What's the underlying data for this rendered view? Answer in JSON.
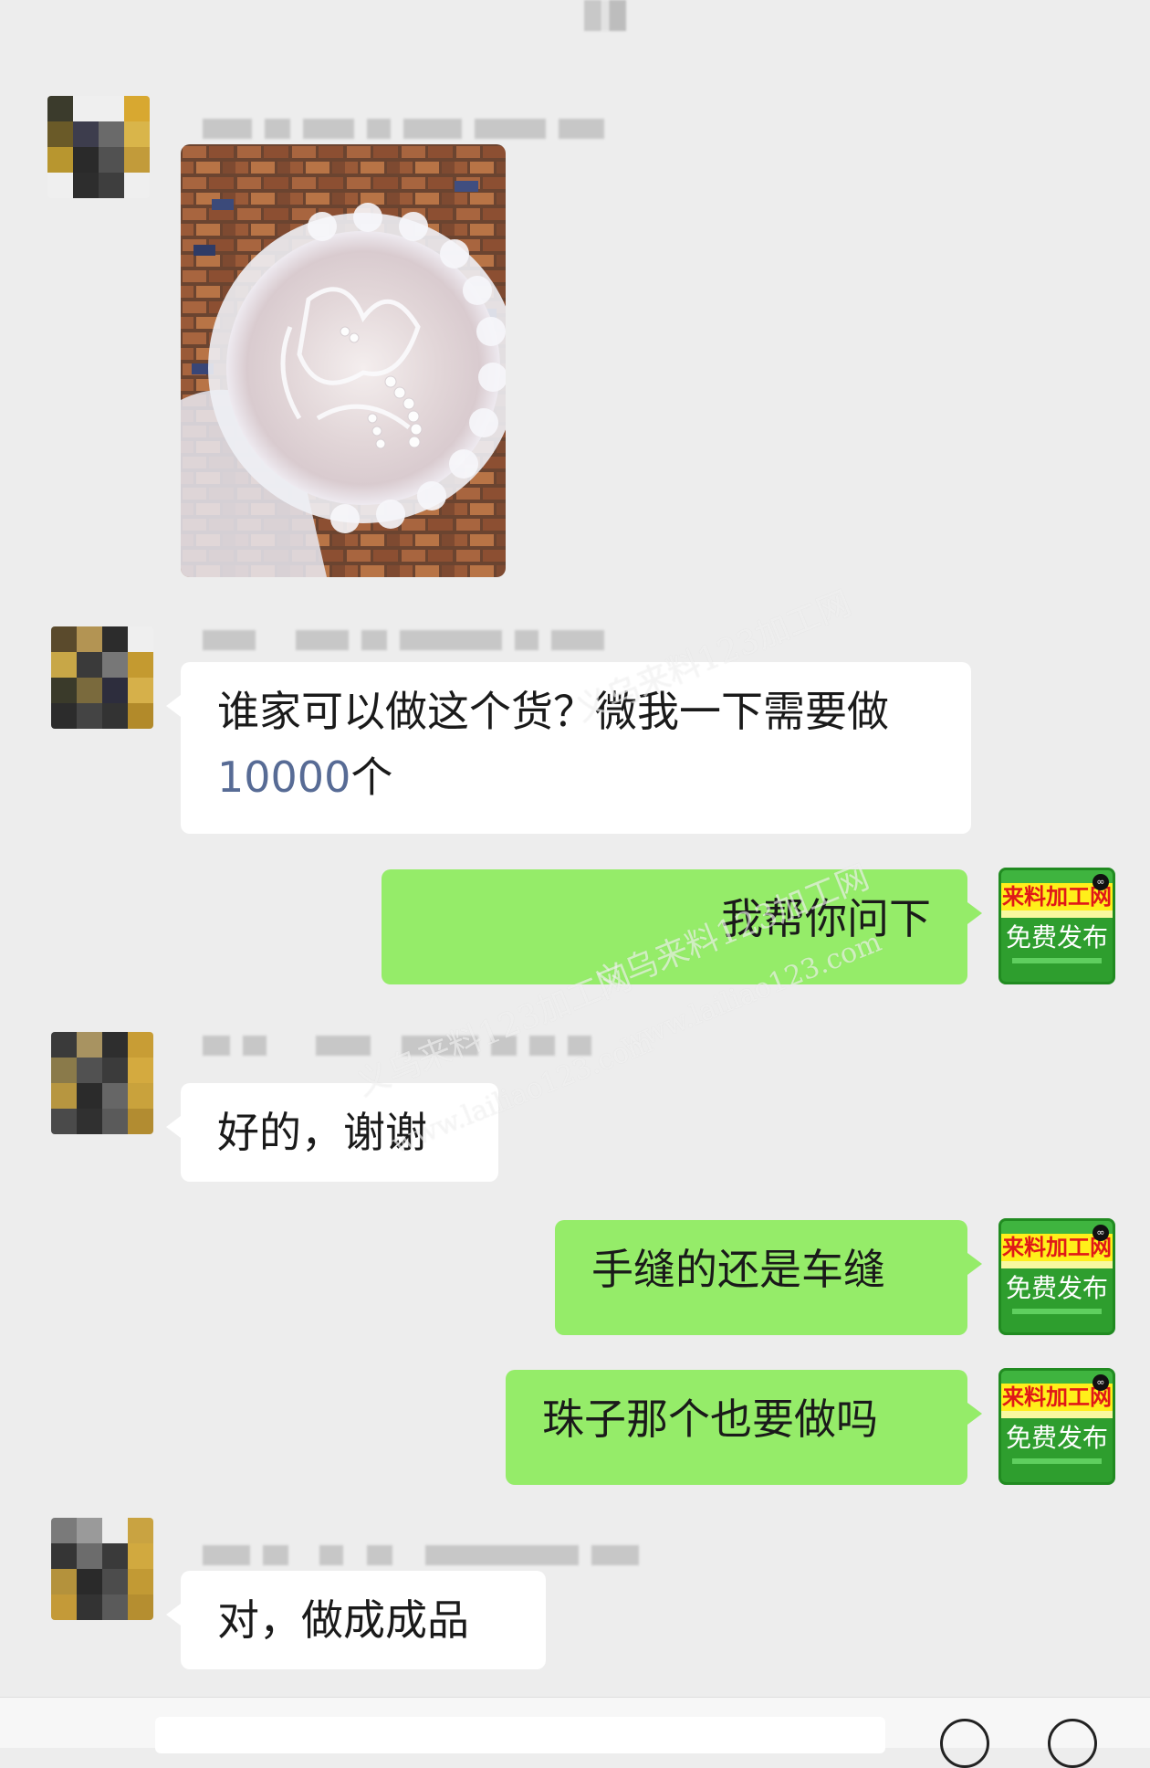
{
  "messages": [
    {
      "from": "other",
      "type": "image",
      "alt": "蕾丝珍珠头饰图片"
    },
    {
      "from": "other",
      "type": "text",
      "text_before": "谁家可以做这个货？微我一下需要做",
      "number": "10000",
      "text_after": "个"
    },
    {
      "from": "self",
      "type": "text",
      "text": "我帮你问下"
    },
    {
      "from": "other",
      "type": "text",
      "text": "好的，谢谢"
    },
    {
      "from": "self",
      "type": "text",
      "text": "手缝的还是车缝"
    },
    {
      "from": "self",
      "type": "text",
      "text": "珠子那个也要做吗"
    },
    {
      "from": "other",
      "type": "text",
      "text": "对，做成成品"
    }
  ],
  "self_avatar": {
    "brand": "来料加工网",
    "cta": "免费发布"
  },
  "watermarks": {
    "cn": "义乌来料123加工网",
    "url": "www.lailiao123.com"
  },
  "colors": {
    "background": "#ededed",
    "self_bubble": "#95ec69",
    "other_bubble": "#ffffff",
    "number_link": "#576b95"
  }
}
